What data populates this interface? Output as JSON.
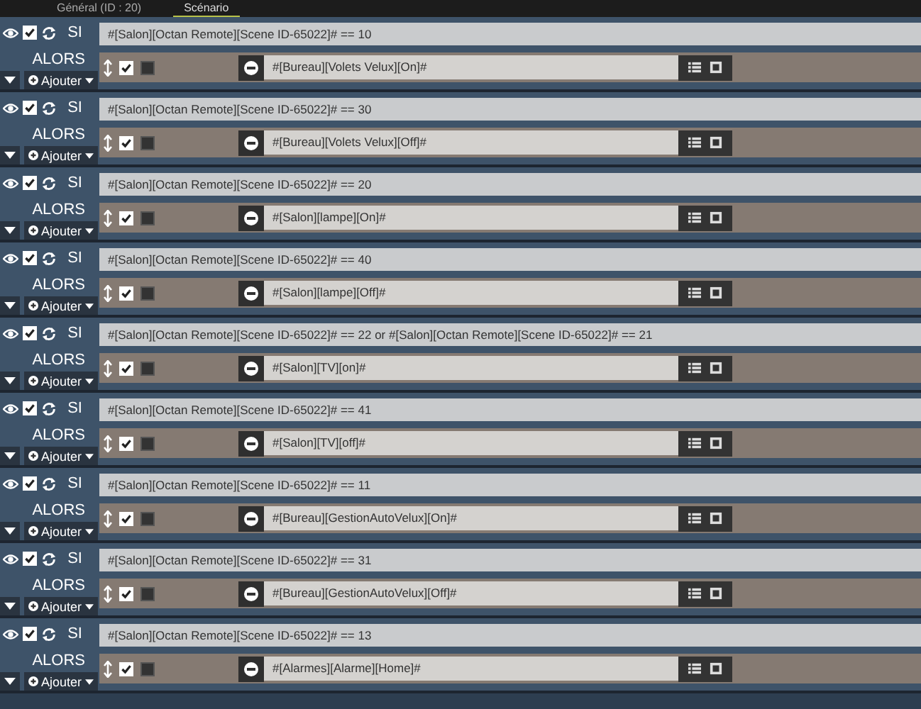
{
  "tabs": [
    {
      "label": "Général (ID : 20)",
      "selected": false
    },
    {
      "label": "Scénario",
      "selected": true
    }
  ],
  "blocks": [
    {
      "if_label": "SI",
      "condition": "#[Salon][Octan Remote][Scene ID-65022]# == 10",
      "then_label": "ALORS",
      "add_label": "Ajouter",
      "action": "#[Bureau][Volets Velux][On]#",
      "enabled": true,
      "option": false
    },
    {
      "if_label": "SI",
      "condition": "#[Salon][Octan Remote][Scene ID-65022]# == 30",
      "then_label": "ALORS",
      "add_label": "Ajouter",
      "action": "#[Bureau][Volets Velux][Off]#",
      "enabled": true,
      "option": false
    },
    {
      "if_label": "SI",
      "condition": "#[Salon][Octan Remote][Scene ID-65022]# == 20",
      "then_label": "ALORS",
      "add_label": "Ajouter",
      "action": "#[Salon][lampe][On]#",
      "enabled": true,
      "option": false
    },
    {
      "if_label": "SI",
      "condition": "#[Salon][Octan Remote][Scene ID-65022]# == 40",
      "then_label": "ALORS",
      "add_label": "Ajouter",
      "action": "#[Salon][lampe][Off]#",
      "enabled": true,
      "option": false
    },
    {
      "if_label": "SI",
      "condition": "#[Salon][Octan Remote][Scene ID-65022]# == 22 or #[Salon][Octan Remote][Scene ID-65022]# == 21",
      "then_label": "ALORS",
      "add_label": "Ajouter",
      "action": "#[Salon][TV][on]#",
      "enabled": true,
      "option": false
    },
    {
      "if_label": "SI",
      "condition": "#[Salon][Octan Remote][Scene ID-65022]# == 41",
      "then_label": "ALORS",
      "add_label": "Ajouter",
      "action": "#[Salon][TV][off]#",
      "enabled": true,
      "option": false
    },
    {
      "if_label": "SI",
      "condition": "#[Salon][Octan Remote][Scene ID-65022]# == 11",
      "then_label": "ALORS",
      "add_label": "Ajouter",
      "action": "#[Bureau][GestionAutoVelux][On]#",
      "enabled": true,
      "option": false
    },
    {
      "if_label": "SI",
      "condition": "#[Salon][Octan Remote][Scene ID-65022]# == 31",
      "then_label": "ALORS",
      "add_label": "Ajouter",
      "action": "#[Bureau][GestionAutoVelux][Off]#",
      "enabled": true,
      "option": false
    },
    {
      "if_label": "SI",
      "condition": "#[Salon][Octan Remote][Scene ID-65022]# == 13",
      "then_label": "ALORS",
      "add_label": "Ajouter",
      "action": "#[Alarmes][Alarme][Home]#",
      "enabled": true,
      "option": false
    }
  ]
}
